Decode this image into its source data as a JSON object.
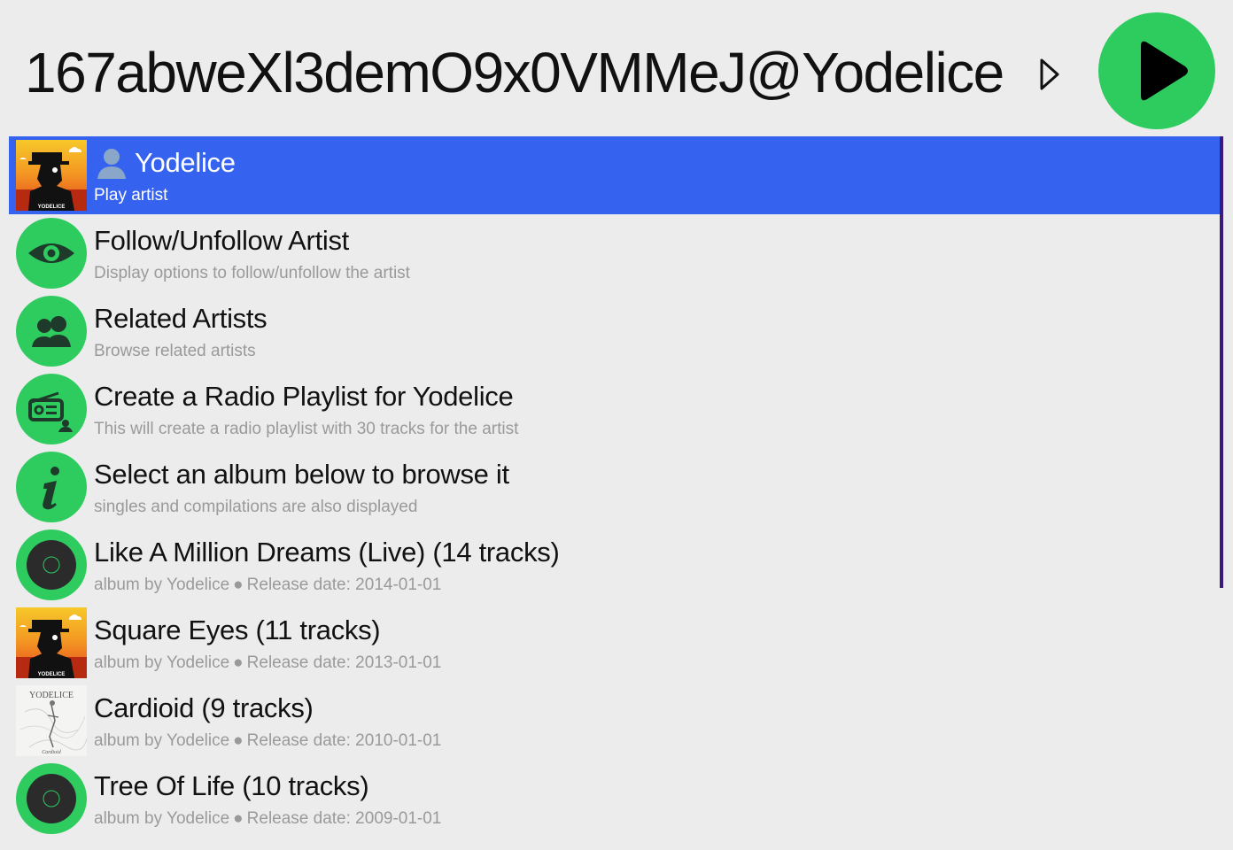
{
  "header": {
    "query": "167abweXl3demO9x0VMMeJ@Yodelice",
    "caret_icon": "caret-right-icon",
    "play_icon": "play-icon",
    "accent_color": "#2ecc5f"
  },
  "list": {
    "selected_color": "#3563f0",
    "items": [
      {
        "title": "Yodelice",
        "subtitle": "Play artist",
        "icon": "user-icon",
        "thumb": "artist-cover"
      },
      {
        "title": "Follow/Unfollow Artist",
        "subtitle": "Display options to follow/unfollow the artist",
        "icon": "eye-icon"
      },
      {
        "title": "Related Artists",
        "subtitle": "Browse related artists",
        "icon": "people-icon"
      },
      {
        "title": "Create a Radio Playlist for Yodelice",
        "subtitle": "This will create a radio playlist with 30 tracks for the artist",
        "icon": "radio-icon"
      },
      {
        "title": "Select an album below to browse it",
        "subtitle": "singles and compilations are also displayed",
        "icon": "info-icon"
      },
      {
        "title": "Like A Million Dreams (Live) (14 tracks)",
        "subtitle_prefix": "album by Yodelice",
        "subtitle_bullet": "●",
        "subtitle_suffix": "Release date: 2014-01-01",
        "icon": "vinyl-icon"
      },
      {
        "title": "Square Eyes (11 tracks)",
        "subtitle_prefix": "album by Yodelice",
        "subtitle_bullet": "●",
        "subtitle_suffix": "Release date: 2013-01-01",
        "thumb": "square-eyes-cover",
        "cover_text": "YODELICE"
      },
      {
        "title": "Cardioid (9 tracks)",
        "subtitle_prefix": "album by Yodelice",
        "subtitle_bullet": "●",
        "subtitle_suffix": "Release date: 2010-01-01",
        "thumb": "cardioid-cover",
        "cover_text": "YODELICE",
        "cover_subtext": "Cardioid"
      },
      {
        "title": "Tree Of Life (10 tracks)",
        "subtitle_prefix": "album by Yodelice",
        "subtitle_bullet": "●",
        "subtitle_suffix": "Release date: 2009-01-01",
        "icon": "vinyl-icon"
      }
    ]
  }
}
